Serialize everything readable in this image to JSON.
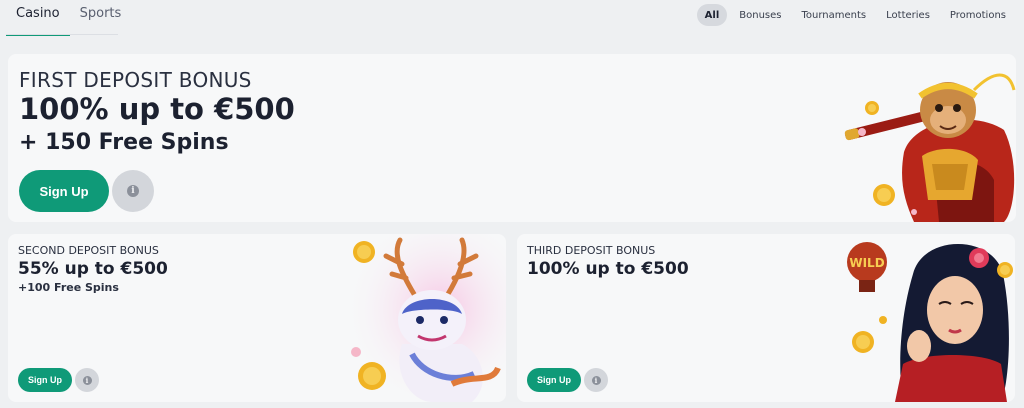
{
  "nav": {
    "tabs": [
      {
        "label": "Casino",
        "active": true
      },
      {
        "label": "Sports",
        "active": false
      }
    ],
    "filters": [
      {
        "label": "All",
        "active": true
      },
      {
        "label": "Bonuses",
        "active": false
      },
      {
        "label": "Tournaments",
        "active": false
      },
      {
        "label": "Lotteries",
        "active": false
      },
      {
        "label": "Promotions",
        "active": false
      }
    ]
  },
  "hero": {
    "kicker": "FIRST DEPOSIT BONUS",
    "headline": "100% up to €500",
    "subline": "+ 150 Free Spins",
    "cta_label": "Sign Up",
    "info_icon": "info-icon",
    "art": "monkey-king-illustration"
  },
  "second": {
    "kicker": "SECOND DEPOSIT BONUS",
    "headline": "55% up to €500",
    "subline": "+100 Free Spins",
    "cta_label": "Sign Up",
    "info_icon": "info-icon",
    "art": "dragon-illustration"
  },
  "third": {
    "kicker": "THIRD DEPOSIT BONUS",
    "headline": "100% up to €500",
    "cta_label": "Sign Up",
    "info_icon": "info-icon",
    "art": "woman-with-wild-lantern-illustration",
    "art_text": "WILD"
  },
  "colors": {
    "accent": "#0f9a78",
    "card_bg": "#f7f8f9",
    "page_bg": "#eef0f2"
  }
}
